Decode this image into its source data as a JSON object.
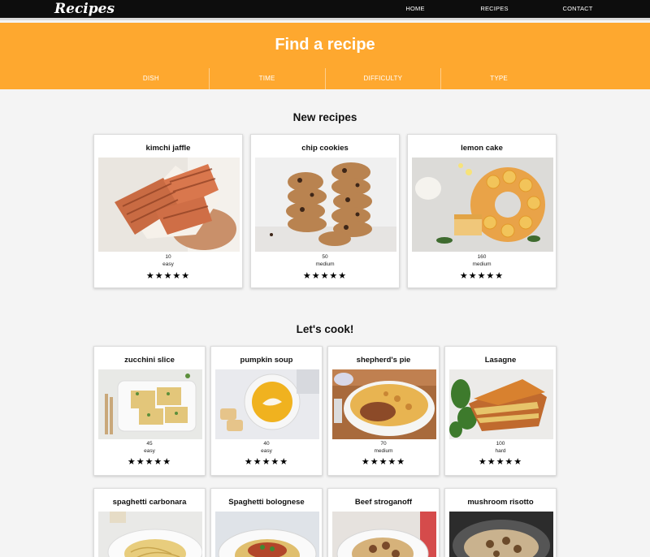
{
  "header": {
    "logo": "Recipes",
    "nav": [
      "HOME",
      "RECIPES",
      "CONTACT"
    ],
    "active_nav": "RECIPES"
  },
  "hero": {
    "title": "Find a recipe",
    "filters": [
      "DISH",
      "TIME",
      "DIFFICULTY",
      "TYPE"
    ]
  },
  "new_recipes": {
    "title": "New recipes",
    "cards": [
      {
        "title": "kimchi jaffle",
        "time": "10",
        "difficulty": "easy",
        "stars": "★★★★★",
        "image": "toasted-sandwich-photo"
      },
      {
        "title": "chip cookies",
        "time": "50",
        "difficulty": "medium",
        "stars": "★★★★★",
        "image": "cookies-photo"
      },
      {
        "title": "lemon cake",
        "time": "160",
        "difficulty": "medium",
        "stars": "★★★★★",
        "image": "lemon-cake-photo"
      }
    ]
  },
  "lets_cook": {
    "title": "Let's cook!",
    "cards": [
      {
        "title": "zucchini slice",
        "time": "45",
        "difficulty": "easy",
        "stars": "★★★★★",
        "image": "zucchini-slice-photo"
      },
      {
        "title": "pumpkin soup",
        "time": "40",
        "difficulty": "easy",
        "stars": "★★★★★",
        "image": "pumpkin-soup-photo"
      },
      {
        "title": "shepherd's pie",
        "time": "70",
        "difficulty": "medium",
        "stars": "★★★★★",
        "image": "shepherds-pie-photo"
      },
      {
        "title": "Lasagne",
        "time": "100",
        "difficulty": "hard",
        "stars": "★★★★★",
        "image": "lasagne-photo"
      },
      {
        "title": "spaghetti carbonara",
        "time": "",
        "difficulty": "",
        "stars": "",
        "image": "carbonara-photo"
      },
      {
        "title": "Spaghetti bolognese",
        "time": "",
        "difficulty": "",
        "stars": "",
        "image": "bolognese-photo"
      },
      {
        "title": "Beef stroganoff",
        "time": "",
        "difficulty": "",
        "stars": "",
        "image": "stroganoff-photo"
      },
      {
        "title": "mushroom risotto",
        "time": "",
        "difficulty": "",
        "stars": "",
        "image": "risotto-photo"
      }
    ]
  },
  "colors": {
    "nav_bg": "#0d0d0d",
    "accent": "#fea82f",
    "page_bg": "#f4f4f4"
  }
}
